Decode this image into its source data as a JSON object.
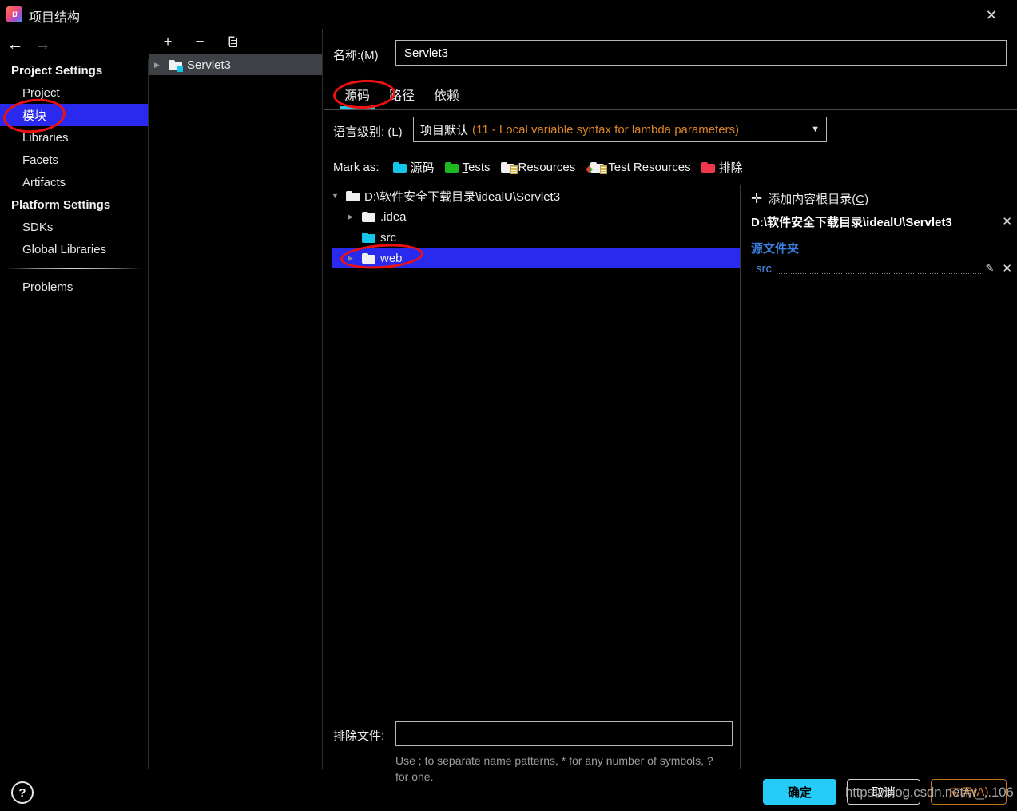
{
  "window": {
    "title": "项目结构",
    "app_icon": "intellij-idea-icon",
    "close_label": "✕"
  },
  "nav": {
    "back": "←",
    "forward": "→"
  },
  "sidebar": {
    "groups": [
      {
        "label": "Project Settings",
        "items": [
          {
            "label": "Project",
            "selected": false
          },
          {
            "label": "模块",
            "selected": true
          },
          {
            "label": "Libraries",
            "selected": false
          },
          {
            "label": "Facets",
            "selected": false
          },
          {
            "label": "Artifacts",
            "selected": false
          }
        ]
      },
      {
        "label": "Platform Settings",
        "items": [
          {
            "label": "SDKs",
            "selected": false
          },
          {
            "label": "Global Libraries",
            "selected": false
          }
        ]
      }
    ],
    "problems": "Problems"
  },
  "modules_panel": {
    "toolbar": {
      "add": "+",
      "remove": "−",
      "copy": "copy-icon"
    },
    "rows": [
      {
        "label": "Servlet3",
        "expander": "▶",
        "icon": "module-folder-icon"
      }
    ]
  },
  "detail": {
    "name_label": "名称:(M)",
    "name_value": "Servlet3",
    "tabs": [
      {
        "label": "源码",
        "active": true
      },
      {
        "label": "路径",
        "active": false
      },
      {
        "label": "依赖",
        "active": false
      }
    ],
    "language_level": {
      "label": "语言级别: (L)",
      "value_main": "项目默认",
      "value_detail": "(11 - Local variable syntax for lambda parameters)",
      "caret": "▼"
    },
    "mark_as": {
      "label": "Mark as:",
      "options": [
        {
          "label": "源码",
          "icon": "folder-cyan-icon",
          "mnemonic": ""
        },
        {
          "label": "Tests",
          "icon": "folder-green-icon",
          "mnemonic": "T"
        },
        {
          "label": "Resources",
          "icon": "folder-resources-icon",
          "mnemonic": ""
        },
        {
          "label": "Test Resources",
          "icon": "folder-test-resources-icon",
          "mnemonic": ""
        },
        {
          "label": "排除",
          "icon": "folder-red-icon",
          "mnemonic": ""
        }
      ]
    },
    "tree": [
      {
        "label": "D:\\软件安全下载目录\\idealU\\Servlet3",
        "expander": "▼",
        "indent": 0,
        "icon": "folder-white-icon",
        "selected": false
      },
      {
        "label": ".idea",
        "expander": "▶",
        "indent": 1,
        "icon": "folder-white-icon",
        "selected": false
      },
      {
        "label": "src",
        "expander": "",
        "indent": 1,
        "icon": "folder-cyan-icon",
        "selected": false
      },
      {
        "label": "web",
        "expander": "▶",
        "indent": 1,
        "icon": "folder-white-icon",
        "selected": true
      }
    ],
    "exclude": {
      "label": "排除文件:",
      "value": "",
      "hint": "Use ; to separate name patterns, * for any number of symbols, ? for one."
    }
  },
  "content_roots": {
    "add_label": "添加内容根目录(C)",
    "add_mnemonic": "C",
    "add_icon": "plus-icon",
    "root_path": "D:\\软件安全下载目录\\idealU\\Servlet3",
    "root_remove": "✕",
    "source_folders_label": "源文件夹",
    "folders": [
      {
        "name": "src",
        "edit_icon": "pencil-icon",
        "remove_icon": "close-icon"
      }
    ]
  },
  "footer": {
    "help": "?",
    "ok": "确定",
    "cancel": "取消",
    "apply": "应用(A)",
    "apply_mnemonic": "A",
    "watermark": "https://blog.csdn.net/w_..106"
  },
  "colors": {
    "accent_cyan": "#25ccf7",
    "selection_blue": "#2a2aee",
    "orange": "#d98326",
    "annotation_red": "#ee1111"
  }
}
